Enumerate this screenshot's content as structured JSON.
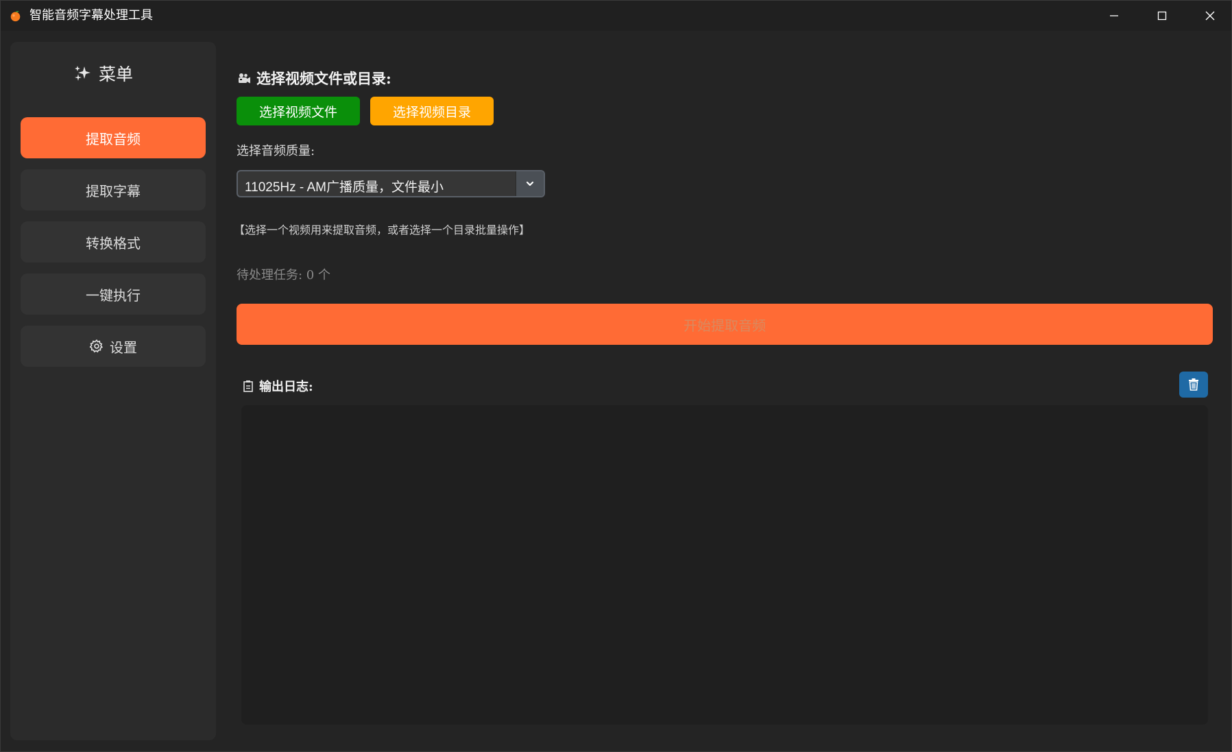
{
  "window": {
    "title": "智能音频字幕处理工具",
    "controls": [
      "minimize",
      "maximize",
      "close"
    ]
  },
  "sidebar": {
    "header": "菜单",
    "header_icon": "sparkles-icon",
    "items": [
      {
        "label": "提取音频",
        "active": true
      },
      {
        "label": "提取字幕",
        "active": false
      },
      {
        "label": "转换格式",
        "active": false
      },
      {
        "label": "一键执行",
        "active": false
      },
      {
        "label": "设置",
        "active": false,
        "icon": "gear-icon"
      }
    ]
  },
  "main": {
    "section_title": "选择视频文件或目录:",
    "section_icon": "video-camera-icon",
    "buttons": {
      "select_file": "选择视频文件",
      "select_dir": "选择视频目录"
    },
    "quality_label": "选择音频质量:",
    "quality_select": {
      "value": "11025Hz - AM广播质量，文件最小"
    },
    "hint": "【选择一个视频用来提取音频，或者选择一个目录批量操作】",
    "pending_tasks": "待处理任务: 0 个",
    "start_button": "开始提取音频",
    "log": {
      "title": "输出日志:",
      "title_icon": "clipboard-icon",
      "clear_icon": "trash-icon",
      "content": ""
    }
  },
  "colors": {
    "accent": "#ff6b35",
    "file_button": "#0a8f0a",
    "dir_button": "#ffa500",
    "clear_button": "#1f6aa5",
    "background": "#242424",
    "sidebar": "#2b2b2b"
  }
}
